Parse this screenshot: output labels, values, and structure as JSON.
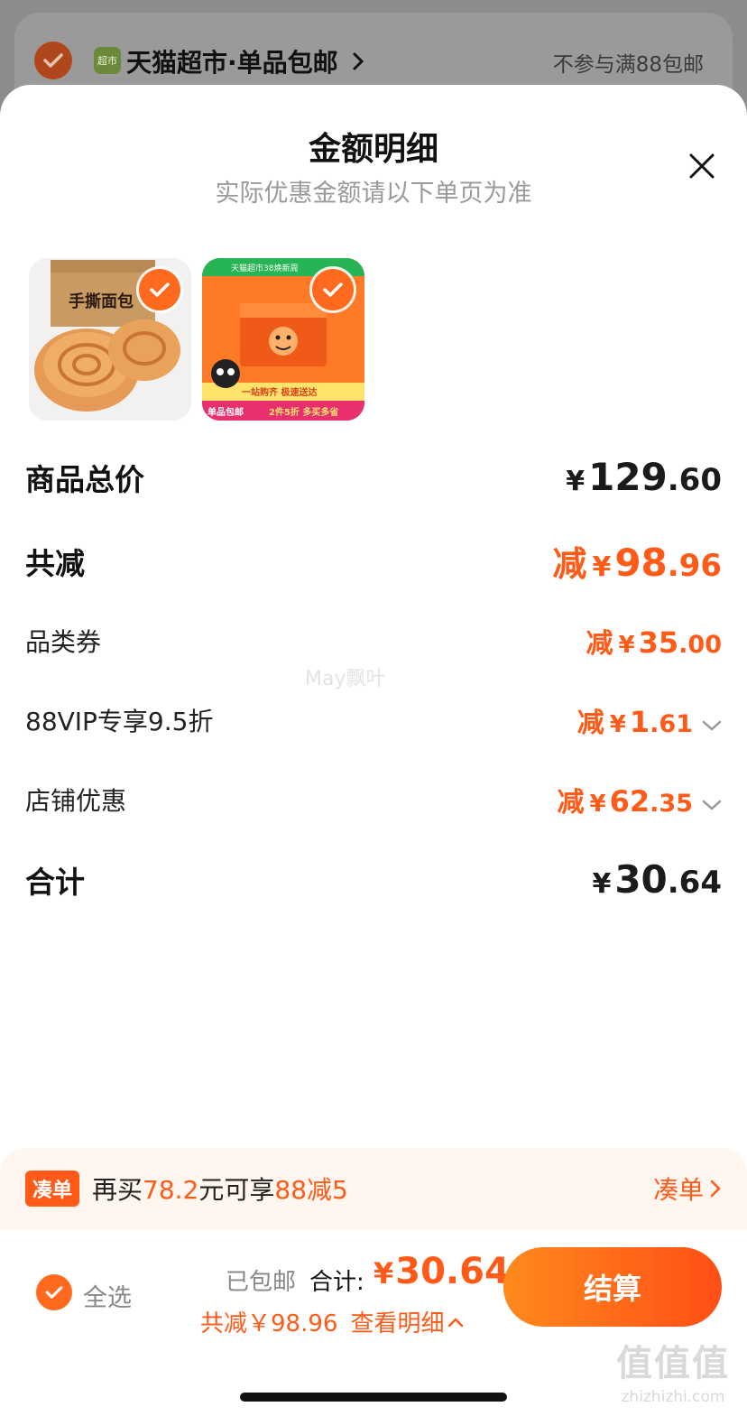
{
  "background": {
    "store_title": "天猫超市·单品包邮",
    "store_logo_text": "超市",
    "store_note": "不参与满88包邮"
  },
  "sheet": {
    "title": "金额明细",
    "subtitle": "实际优惠金额请以下单页为准"
  },
  "products": [
    {
      "name": "手撕面包",
      "badge": ""
    },
    {
      "name": "天猫超市38焕新周",
      "badge": "单品包邮",
      "promo": "2件5折 多买多省",
      "slogan": "一站购齐 极速送达"
    }
  ],
  "rows": {
    "goods_total": {
      "label": "商品总价",
      "yen": "¥",
      "int": "129",
      "dec": ".60"
    },
    "total_discount": {
      "label": "共减",
      "prefix": "减",
      "yen": "¥",
      "int": "98",
      "dec": ".96"
    },
    "category_coupon": {
      "label": "品类券",
      "prefix": "减",
      "yen": "¥",
      "int": "35",
      "dec": ".00"
    },
    "vip_discount": {
      "label": "88VIP专享9.5折",
      "prefix": "减",
      "yen": "¥",
      "int": "1",
      "dec": ".61"
    },
    "store_discount": {
      "label": "店铺优惠",
      "prefix": "减",
      "yen": "¥",
      "int": "62",
      "dec": ".35"
    },
    "grand_total": {
      "label": "合计",
      "yen": "¥",
      "int": "30",
      "dec": ".64"
    }
  },
  "watermark": "May飘叶",
  "bundle": {
    "tag": "凑单",
    "text_pre": "再买",
    "amount": "78.2",
    "text_mid": "元可享",
    "offer": "88减5",
    "link": "凑单"
  },
  "bottom": {
    "select_all": "全选",
    "shipping": "已包邮",
    "total_label": "合计:",
    "total_yen": "¥",
    "total_value": "30.64",
    "save_text": "共减￥98.96",
    "detail_link": "查看明细",
    "checkout": "结算"
  },
  "site_watermark": {
    "big": "值值值",
    "small": "zhizhizhi.com"
  },
  "colors": {
    "accent": "#ff5a17",
    "checkout_start": "#ff8a1c",
    "checkout_end": "#ff4e16"
  }
}
